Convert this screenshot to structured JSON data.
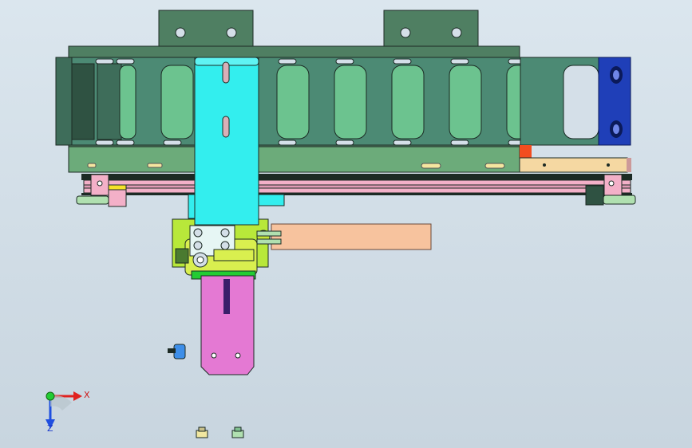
{
  "view": {
    "background": "#d4dfe8",
    "model_type": "cad-assembly-front-view"
  },
  "colors": {
    "frame_green": "#4f7f62",
    "frame_dark": "#2f5242",
    "link_green": "#6cc38f",
    "carriage_cyan": "#33eeee",
    "lime": "#b8e83a",
    "pink": "#e479d3",
    "salmon": "#f7c39e",
    "blue_block": "#1f3fb8",
    "orange_part": "#f5d8a2",
    "rail_pink": "#f3b0c8",
    "edge": "#1c2a24"
  },
  "triad": {
    "x_label": "X",
    "z_label": "Z",
    "x_color": "#e0221f",
    "z_color": "#1f4fe0",
    "origin_color": "#22cc33"
  }
}
